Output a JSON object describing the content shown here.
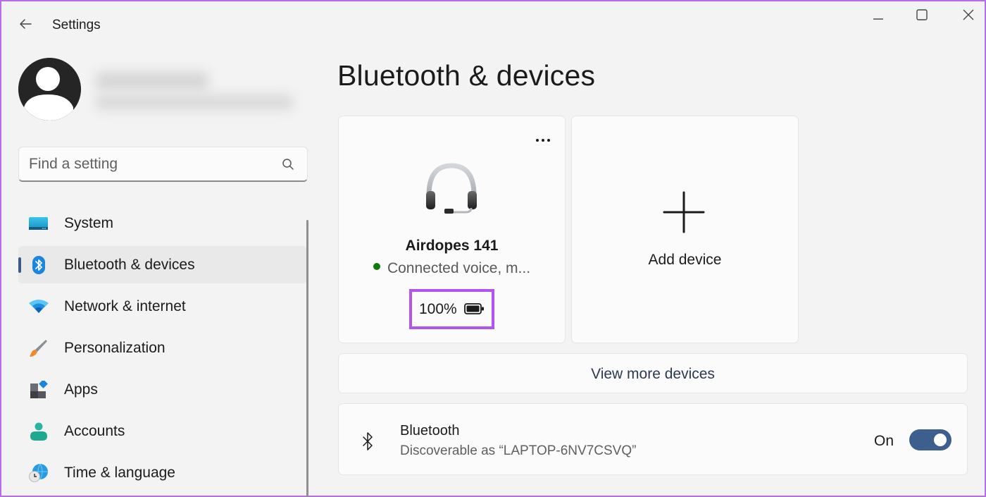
{
  "window": {
    "title": "Settings",
    "controls": [
      "minimize",
      "maximize",
      "close"
    ]
  },
  "profile": {
    "name": "",
    "email": "",
    "blurred": true
  },
  "search": {
    "placeholder": "Find a setting",
    "value": ""
  },
  "sidebar": {
    "items": [
      {
        "label": "System",
        "icon": "system-icon",
        "active": false
      },
      {
        "label": "Bluetooth & devices",
        "icon": "bluetooth-icon",
        "active": true
      },
      {
        "label": "Network & internet",
        "icon": "wifi-icon",
        "active": false
      },
      {
        "label": "Personalization",
        "icon": "paintbrush-icon",
        "active": false
      },
      {
        "label": "Apps",
        "icon": "apps-icon",
        "active": false
      },
      {
        "label": "Accounts",
        "icon": "accounts-icon",
        "active": false
      },
      {
        "label": "Time & language",
        "icon": "time-language-icon",
        "active": false
      }
    ]
  },
  "main": {
    "title": "Bluetooth & devices",
    "device_card": {
      "name": "Airdopes 141",
      "status": "Connected voice, m...",
      "status_color": "#0f7b0f",
      "battery": "100%",
      "battery_level": 1.0,
      "icon": "headset-icon",
      "highlight_color": "#b155ee"
    },
    "add_card": {
      "label": "Add device",
      "icon": "plus-icon"
    },
    "view_more": {
      "label": "View more devices"
    },
    "bluetooth_row": {
      "title": "Bluetooth",
      "subtitle": "Discoverable as “LAPTOP-6NV7CSVQ”",
      "state_label": "On",
      "enabled": true,
      "accent": "#3d5f8e"
    }
  }
}
